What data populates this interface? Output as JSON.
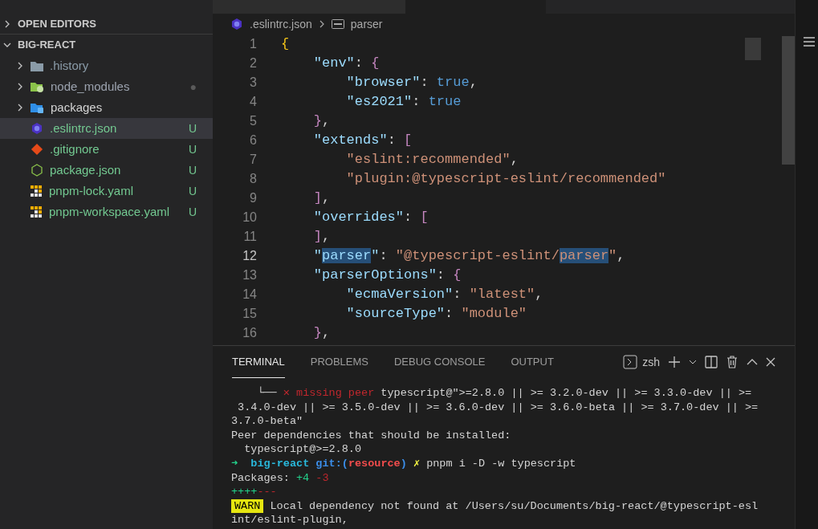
{
  "sidebar": {
    "sections": [
      {
        "label": "OPEN EDITORS",
        "expanded": false
      },
      {
        "label": "BIG-REACT",
        "expanded": true
      }
    ],
    "items": [
      {
        "name": ".history",
        "kind": "folder",
        "selected": false,
        "color": "#8a9ba8"
      },
      {
        "name": "node_modules",
        "kind": "folder",
        "badge": "●",
        "selected": false,
        "color": "#9ca3af"
      },
      {
        "name": "packages",
        "kind": "folder",
        "selected": false,
        "color": "#d4d4d4"
      },
      {
        "name": ".eslintrc.json",
        "kind": "file",
        "badge": "U",
        "selected": true,
        "color": "#73c991"
      },
      {
        "name": ".gitignore",
        "kind": "file",
        "badge": "U",
        "selected": false,
        "color": "#73c991"
      },
      {
        "name": "package.json",
        "kind": "file",
        "badge": "U",
        "selected": false,
        "color": "#73c991"
      },
      {
        "name": "pnpm-lock.yaml",
        "kind": "file",
        "badge": "U",
        "selected": false,
        "color": "#73c991"
      },
      {
        "name": "pnpm-workspace.yaml",
        "kind": "file",
        "badge": "U",
        "selected": false,
        "color": "#73c991"
      }
    ]
  },
  "breadcrumb": {
    "file": ".eslintrc.json",
    "symbol": "parser"
  },
  "code": [
    {
      "number": "1",
      "tokens": [
        {
          "text": "{",
          "kind": "brace"
        }
      ]
    },
    {
      "number": "2",
      "tokens": [
        {
          "text": "    \"env\"",
          "kind": "key"
        },
        {
          "text": ": ",
          "kind": "punct"
        },
        {
          "text": "{",
          "kind": "bracket"
        }
      ]
    },
    {
      "number": "3",
      "tokens": [
        {
          "text": "        \"browser\"",
          "kind": "key"
        },
        {
          "text": ": ",
          "kind": "punct"
        },
        {
          "text": "true",
          "kind": "bool"
        },
        {
          "text": ",",
          "kind": "punct"
        }
      ]
    },
    {
      "number": "4",
      "tokens": [
        {
          "text": "        \"es2021\"",
          "kind": "key"
        },
        {
          "text": ": ",
          "kind": "punct"
        },
        {
          "text": "true",
          "kind": "bool"
        }
      ]
    },
    {
      "number": "5",
      "tokens": [
        {
          "text": "    }",
          "kind": "bracket"
        },
        {
          "text": ",",
          "kind": "punct"
        }
      ]
    },
    {
      "number": "6",
      "tokens": [
        {
          "text": "    \"extends\"",
          "kind": "key"
        },
        {
          "text": ": ",
          "kind": "punct"
        },
        {
          "text": "[",
          "kind": "bracket"
        }
      ]
    },
    {
      "number": "7",
      "tokens": [
        {
          "text": "        \"eslint:recommended\"",
          "kind": "string"
        },
        {
          "text": ",",
          "kind": "punct"
        }
      ]
    },
    {
      "number": "8",
      "tokens": [
        {
          "text": "        \"plugin:@typescript-eslint/recommended\"",
          "kind": "string"
        }
      ]
    },
    {
      "number": "9",
      "tokens": [
        {
          "text": "    ]",
          "kind": "bracket"
        },
        {
          "text": ",",
          "kind": "punct"
        }
      ]
    },
    {
      "number": "10",
      "tokens": [
        {
          "text": "    \"overrides\"",
          "kind": "key"
        },
        {
          "text": ": ",
          "kind": "punct"
        },
        {
          "text": "[",
          "kind": "bracket"
        }
      ]
    },
    {
      "number": "11",
      "tokens": [
        {
          "text": "    ]",
          "kind": "bracket"
        },
        {
          "text": ",",
          "kind": "punct"
        }
      ]
    },
    {
      "number": "12",
      "tokens": [
        {
          "text": "    \"",
          "kind": "key"
        },
        {
          "text": "parser",
          "kind": "key",
          "highlighted": true
        },
        {
          "text": "\"",
          "kind": "key"
        },
        {
          "text": ": ",
          "kind": "punct"
        },
        {
          "text": "\"@typescript-eslint/",
          "kind": "string"
        },
        {
          "text": "parser",
          "kind": "string",
          "highlighted": true
        },
        {
          "text": "\"",
          "kind": "string"
        },
        {
          "text": ",",
          "kind": "punct"
        }
      ]
    },
    {
      "number": "13",
      "tokens": [
        {
          "text": "    \"parserOptions\"",
          "kind": "key"
        },
        {
          "text": ": ",
          "kind": "punct"
        },
        {
          "text": "{",
          "kind": "bracket"
        }
      ]
    },
    {
      "number": "14",
      "tokens": [
        {
          "text": "        \"ecmaVersion\"",
          "kind": "key"
        },
        {
          "text": ": ",
          "kind": "punct"
        },
        {
          "text": "\"latest\"",
          "kind": "string"
        },
        {
          "text": ",",
          "kind": "punct"
        }
      ]
    },
    {
      "number": "15",
      "tokens": [
        {
          "text": "        \"sourceType\"",
          "kind": "key"
        },
        {
          "text": ": ",
          "kind": "punct"
        },
        {
          "text": "\"module\"",
          "kind": "string"
        }
      ]
    },
    {
      "number": "16",
      "tokens": [
        {
          "text": "    }",
          "kind": "bracket"
        },
        {
          "text": ",",
          "kind": "punct"
        }
      ]
    }
  ],
  "panel": {
    "tabs": [
      {
        "label": "TERMINAL",
        "selected": true
      },
      {
        "label": "PROBLEMS",
        "selected": false
      },
      {
        "label": "DEBUG CONSOLE",
        "selected": false
      },
      {
        "label": "OUTPUT",
        "selected": false
      }
    ],
    "shell": "zsh"
  },
  "terminal": [
    [
      {
        "text": "    └── ",
        "kind": "plain"
      },
      {
        "text": "✕ missing peer",
        "kind": "error"
      },
      {
        "text": " typescript@\">=2.8.0 || >= 3.2.0-dev || >= 3.3.0-dev || >=",
        "kind": "plain"
      }
    ],
    [
      {
        "text": " 3.4.0-dev || >= 3.5.0-dev || >= 3.6.0-dev || >= 3.6.0-beta || >= 3.7.0-dev || >=",
        "kind": "plain"
      }
    ],
    [
      {
        "text": "3.7.0-beta\"",
        "kind": "plain"
      }
    ],
    [
      {
        "text": "Peer dependencies that should be installed:",
        "kind": "plain"
      }
    ],
    [
      {
        "text": "  typescript@>=2.8.0",
        "kind": "plain"
      }
    ],
    [
      {
        "text": "➜",
        "kind": "arrow"
      },
      {
        "text": "  big-react",
        "kind": "dir"
      },
      {
        "text": " git:(",
        "kind": "git"
      },
      {
        "text": "resource",
        "kind": "branch"
      },
      {
        "text": ")",
        "kind": "git"
      },
      {
        "text": " ✗",
        "kind": "dirty"
      },
      {
        "text": " pnpm i -D -w typescript",
        "kind": "plain"
      }
    ],
    [
      {
        "text": "Packages: ",
        "kind": "plain"
      },
      {
        "text": "+4",
        "kind": "added"
      },
      {
        "text": " -3",
        "kind": "removed"
      }
    ],
    [
      {
        "text": "++++",
        "kind": "added"
      },
      {
        "text": "---",
        "kind": "removed"
      }
    ],
    [
      {
        "text": "WARN",
        "kind": "warn"
      },
      {
        "text": " Local dependency not found at /Users/su/Documents/big-react/@typescript-esl",
        "kind": "plain"
      }
    ],
    [
      {
        "text": "int/eslint-plugin,",
        "kind": "plain"
      }
    ]
  ]
}
